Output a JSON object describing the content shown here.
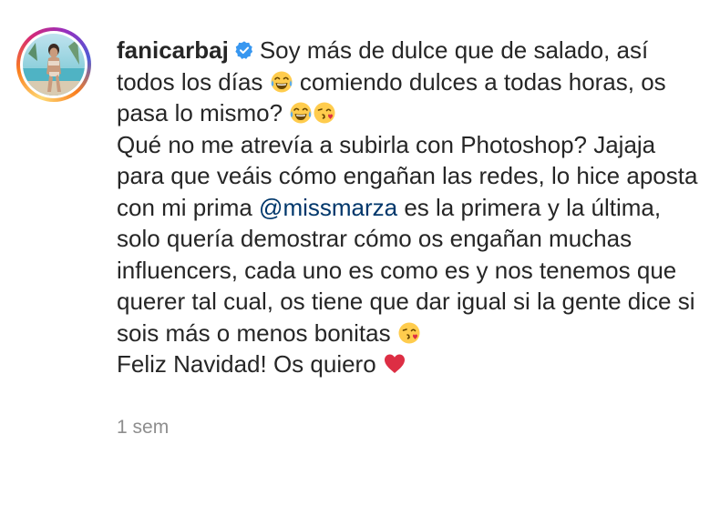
{
  "post": {
    "username": "fanicarbaj",
    "caption": {
      "line1": "Soy más de dulce que de salado, así todos los días ",
      "line1b": " comiendo dulces a todas horas, os pasa lo mismo? ",
      "line2": "Qué no me atrevía a subirla con Photoshop? Jajaja para que veáis cómo engañan las redes, lo hice aposta con mi prima ",
      "mention": "@missmarza",
      "line2b": " es la primera y la última, solo quería demostrar cómo os engañan muchas influencers, cada uno es como es y nos tenemos que querer tal cual, os tiene que dar igual si la gente dice si sois más o menos bonitas ",
      "line3": "Feliz Navidad! Os quiero "
    },
    "timestamp": "1 sem"
  },
  "icons": {
    "verified": "verified-badge-icon",
    "laugh": "tears-of-joy-emoji",
    "kiss": "face-blowing-kiss-emoji",
    "heart": "red-heart-emoji"
  },
  "colors": {
    "text": "#262626",
    "mention": "#00376b",
    "timestamp": "#8e8e8e",
    "verified": "#3897f0"
  }
}
